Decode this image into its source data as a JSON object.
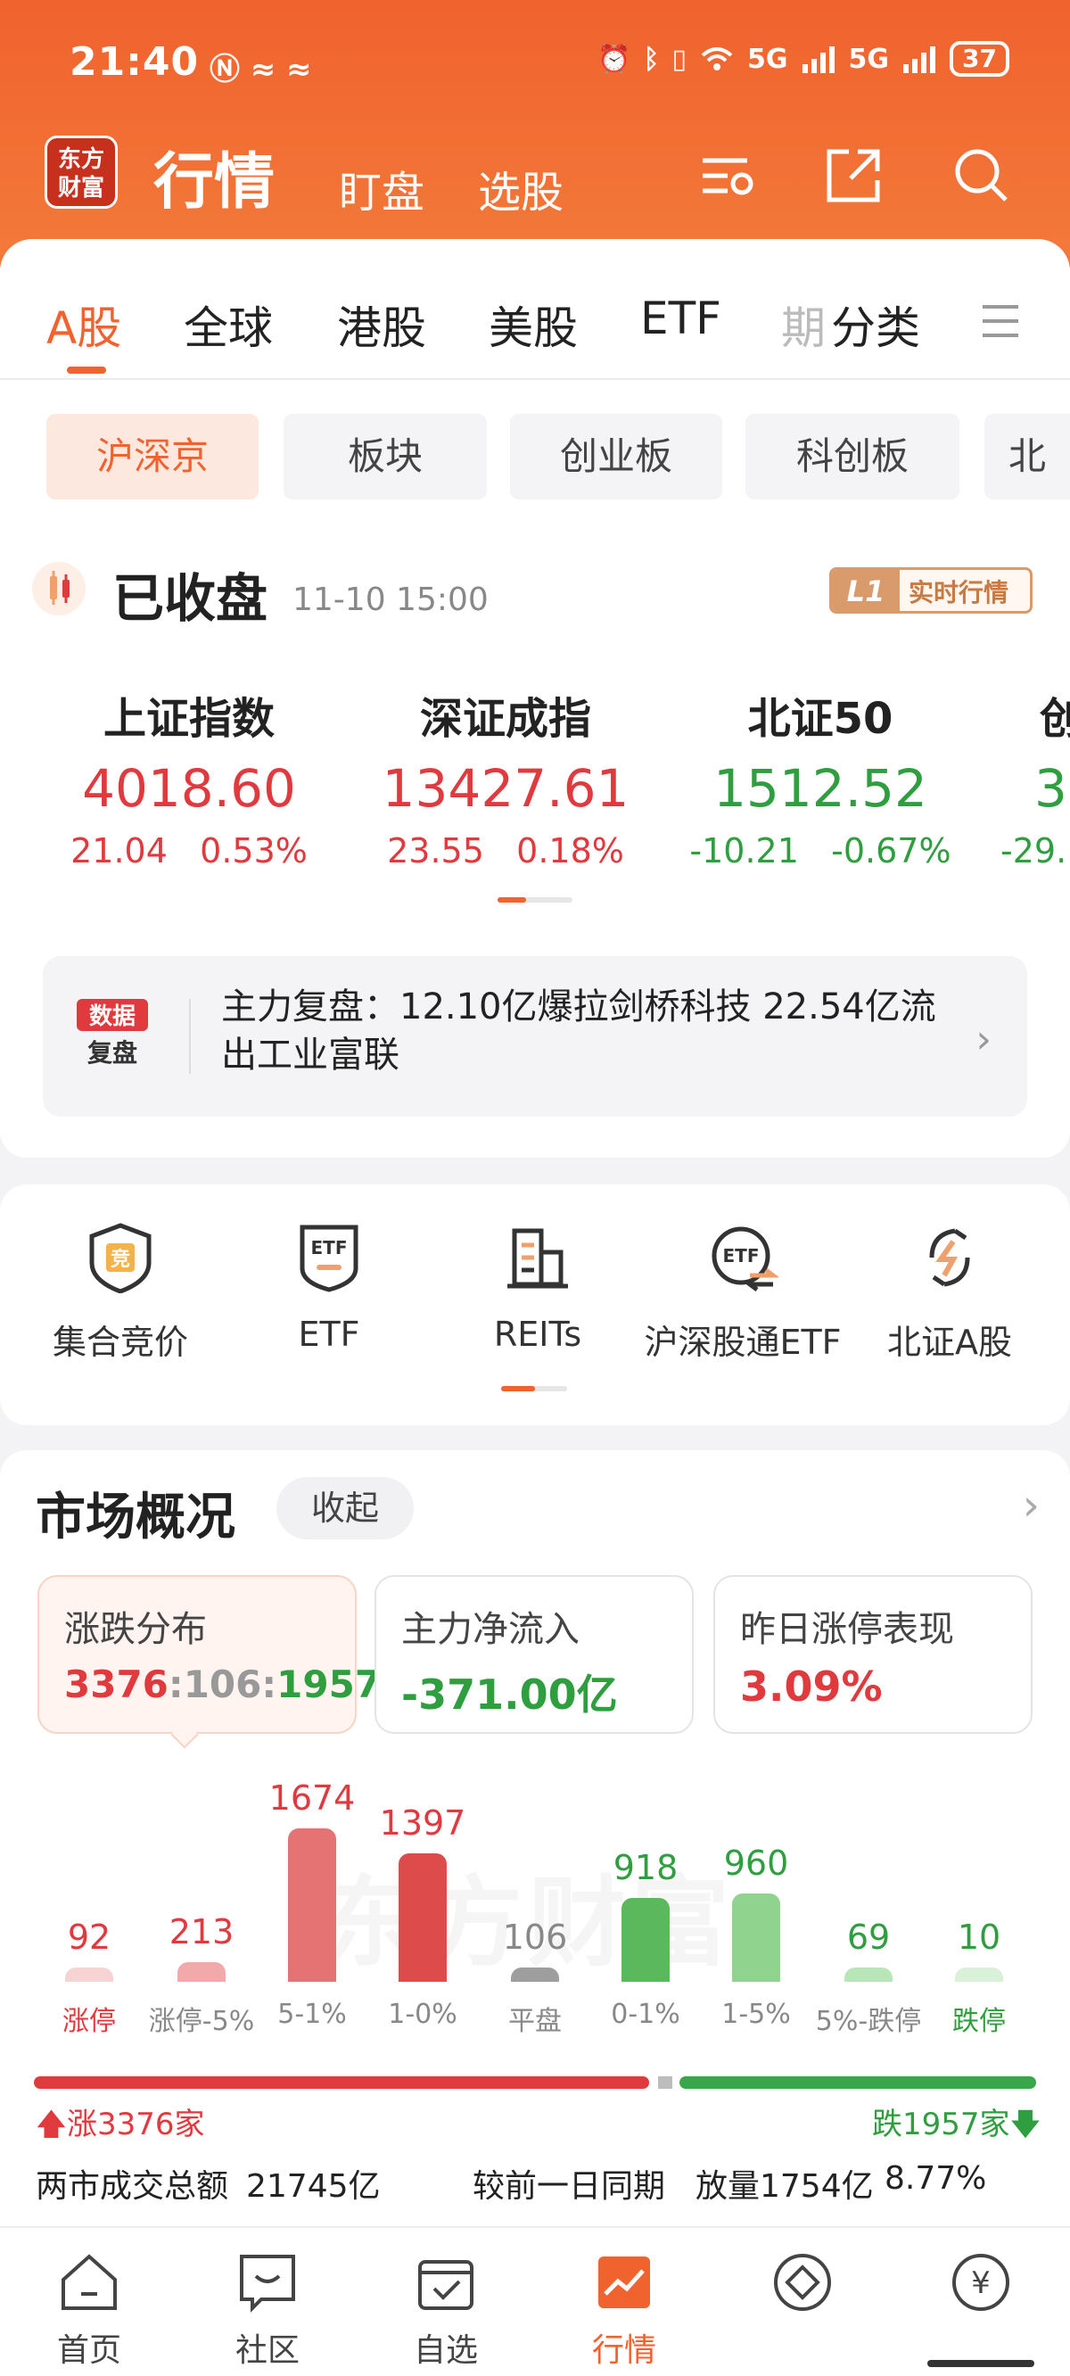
{
  "status_bar": {
    "time": "21:40",
    "battery": "37",
    "signal_1": "5G",
    "signal_2": "5G"
  },
  "app": {
    "logo_text": "东方财富",
    "title": "行情",
    "tabs": [
      "盯盘",
      "选股"
    ]
  },
  "market_tabs": [
    "A股",
    "全球",
    "港股",
    "美股",
    "ETF",
    "期",
    "分类"
  ],
  "sub_tabs": [
    "沪深京",
    "板块",
    "创业板",
    "科创板",
    "北"
  ],
  "session": {
    "status": "已收盘",
    "time": "11-10 15:00",
    "badge_l1": "L1",
    "badge_text": "实时行情"
  },
  "indices": [
    {
      "name": "上证指数",
      "value": "4018.60",
      "change": "21.04",
      "pct": "0.53%",
      "dir": "up"
    },
    {
      "name": "深证成指",
      "value": "13427.61",
      "change": "23.55",
      "pct": "0.18%",
      "dir": "up"
    },
    {
      "name": "北证50",
      "value": "1512.52",
      "change": "-10.21",
      "pct": "-0.67%",
      "dir": "down"
    },
    {
      "name": "创",
      "value": "3",
      "change": "-29.",
      "pct": "",
      "dir": "down"
    }
  ],
  "review": {
    "badge_line1": "数据",
    "badge_line2": "复盘",
    "text": "主力复盘：12.10亿爆拉剑桥科技 22.54亿流出工业富联"
  },
  "quick_entries": [
    {
      "label": "集合竞价",
      "icon": "auction-shield-icon"
    },
    {
      "label": "ETF",
      "icon": "etf-shield-icon"
    },
    {
      "label": "REITs",
      "icon": "reits-building-icon"
    },
    {
      "label": "沪深股通ETF",
      "icon": "etf-exchange-icon"
    },
    {
      "label": "北证A股",
      "icon": "bse-lightning-icon"
    }
  ],
  "market_overview": {
    "title": "市场概况",
    "collapse_label": "收起",
    "stats": [
      {
        "title": "涨跌分布",
        "up": "3376",
        "flat": "106",
        "down": "1957"
      },
      {
        "title": "主力净流入",
        "value": "-371.00亿"
      },
      {
        "title": "昨日涨停表现",
        "value": "3.09%"
      }
    ],
    "watermark": "东方财富",
    "distribution": {
      "type": "bar",
      "categories": [
        "涨停",
        "涨停-5%",
        "5-1%",
        "1-0%",
        "平盘",
        "0-1%",
        "1-5%",
        "5%-跌停",
        "跌停"
      ],
      "values": [
        92,
        213,
        1674,
        1397,
        106,
        918,
        960,
        69,
        10
      ],
      "colors": [
        "#f8d3d3",
        "#f2a9a9",
        "#e57373",
        "#dd4b4b",
        "#9e9e9e",
        "#5cb85c",
        "#8fd38f",
        "#b9e6b9",
        "#d8f1d8"
      ]
    },
    "up_total": "涨3376家",
    "down_total": "跌1957家",
    "turnover_label": "两市成交总额",
    "turnover_value": "21745亿",
    "compare_label": "较前一日同期",
    "compare_value": "放量1754亿",
    "compare_pct": "8.77%"
  },
  "bottom_nav": [
    {
      "label": "首页",
      "icon": "home-icon"
    },
    {
      "label": "社区",
      "icon": "community-icon"
    },
    {
      "label": "自选",
      "icon": "watchlist-icon"
    },
    {
      "label": "行情",
      "icon": "market-icon"
    },
    {
      "label": "",
      "icon": "trade-icon"
    },
    {
      "label": "",
      "icon": "wealth-icon"
    }
  ],
  "chart_data": {
    "type": "bar",
    "categories": [
      "涨停",
      "涨停-5%",
      "5-1%",
      "1-0%",
      "平盘",
      "0-1%",
      "1-5%",
      "5%-跌停",
      "跌停"
    ],
    "values": [
      92,
      213,
      1674,
      1397,
      106,
      918,
      960,
      69,
      10
    ],
    "title": "",
    "xlabel": "",
    "ylabel": ""
  }
}
